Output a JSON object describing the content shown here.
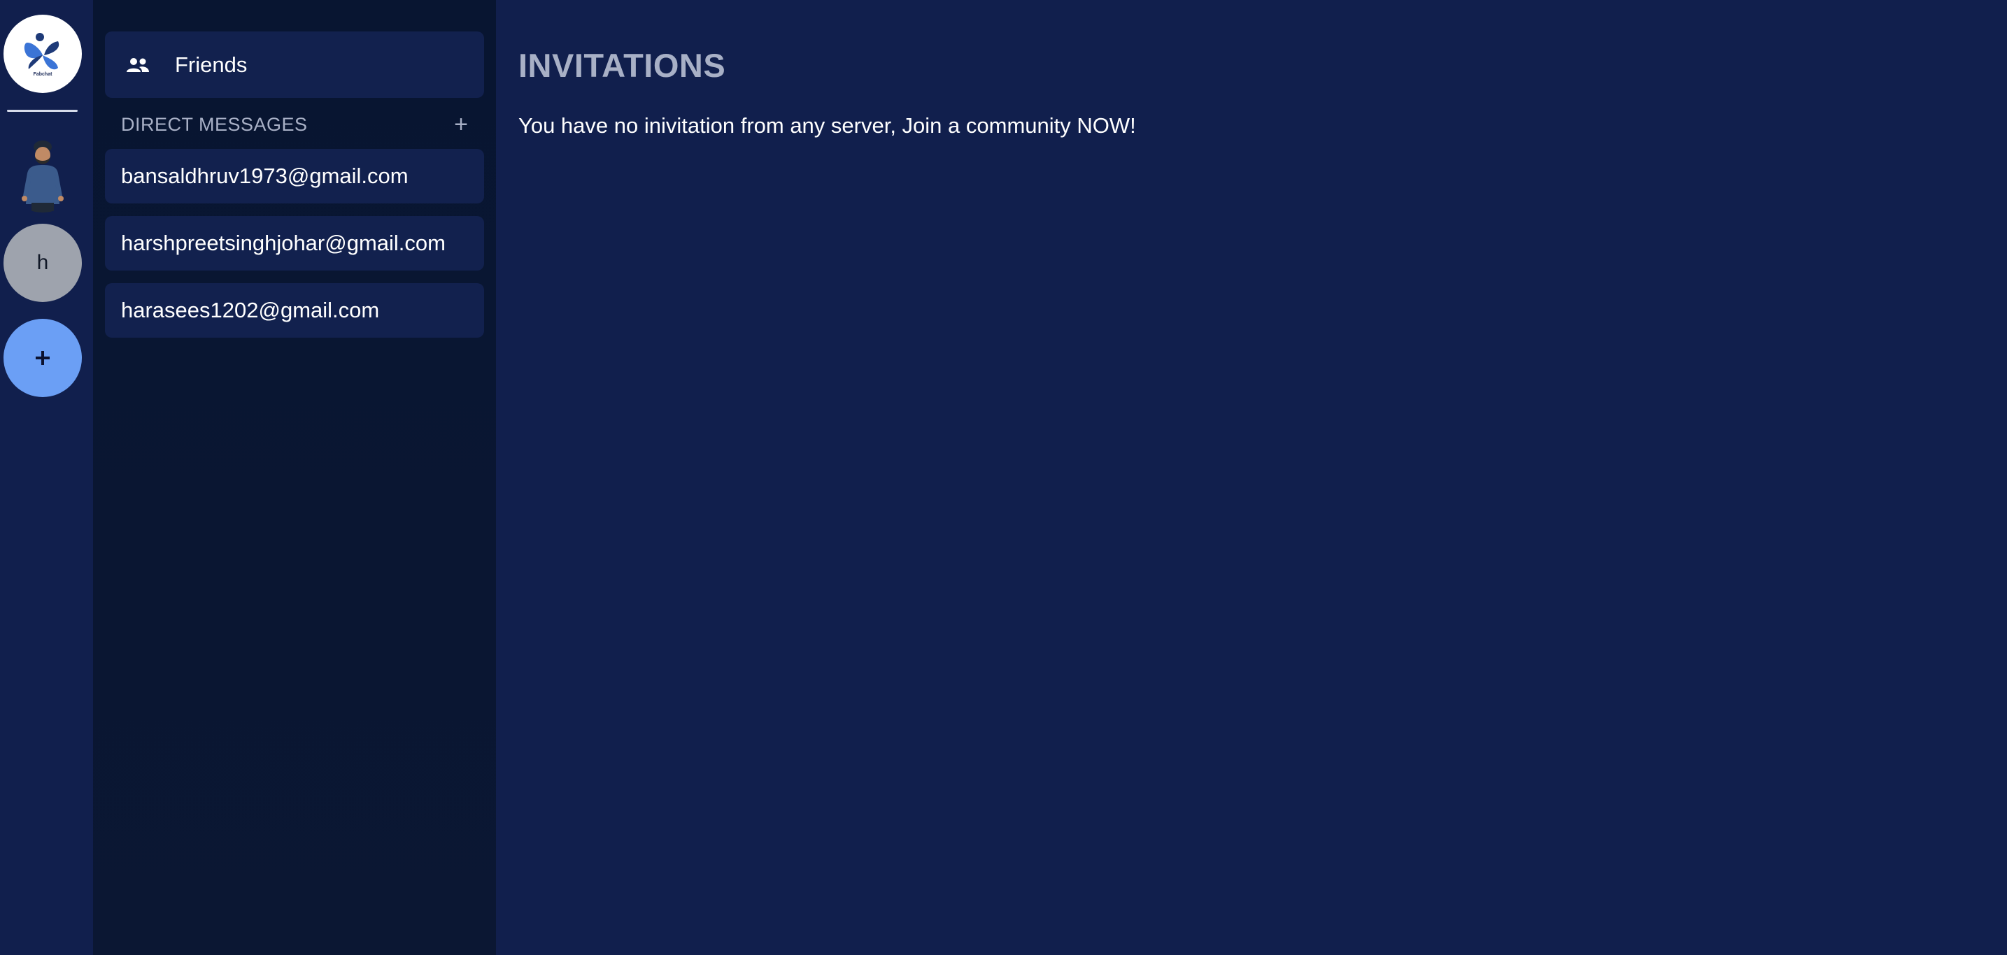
{
  "rail": {
    "logo": {
      "icon": "app-logo-icon",
      "text": "Fabchat"
    },
    "user_avatar": {
      "icon": "user-avatar-icon"
    },
    "server_h": {
      "label": "h"
    },
    "add_server": {
      "label": "+"
    },
    "colors": {
      "rail_bg": "#111f4d",
      "server_h_bg": "#9ea3ad",
      "add_bg": "#6b9ff5"
    }
  },
  "panel": {
    "friends": {
      "label": "Friends",
      "icon": "friends-icon"
    },
    "direct_messages_header": "DIRECT MESSAGES",
    "add_dm_label": "+",
    "dms": [
      {
        "label": "bansaldhruv1973@gmail.com"
      },
      {
        "label": "harshpreetsinghjohar@gmail.com"
      },
      {
        "label": "harasees1202@gmail.com"
      }
    ],
    "colors": {
      "panel_bg": "#081531",
      "item_bg": "#12214e"
    }
  },
  "main": {
    "title": "INVITATIONS",
    "empty_message": "You have no inivitation from any server, Join a community NOW!",
    "colors": {
      "main_bg": "#111f4d",
      "title": "#a8b0c6",
      "text": "#ffffff"
    }
  }
}
